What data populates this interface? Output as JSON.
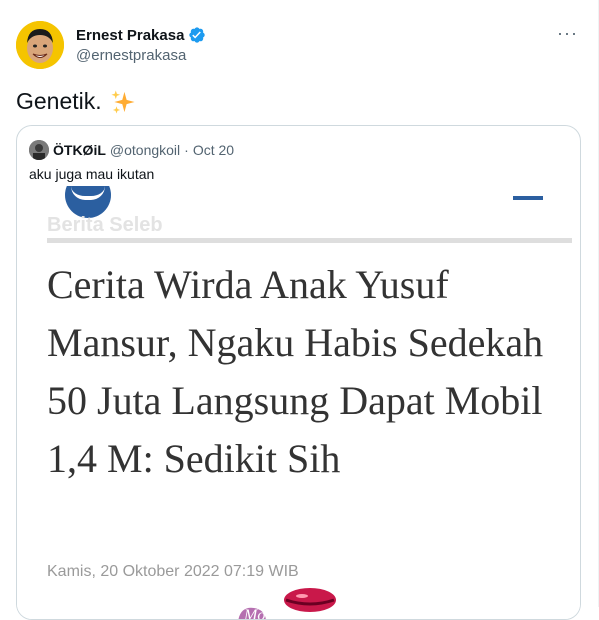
{
  "author": {
    "display_name": "Ernest Prakasa",
    "handle": "@ernestprakasa",
    "verified_icon": "verified-badge-icon",
    "avatar_bg": "#f5c400"
  },
  "tweet": {
    "text": "Genetik.",
    "emoji": "sparkles-icon"
  },
  "more_menu": "···",
  "quoted": {
    "display_name": "ÖTKØiL",
    "handle": "@otongkoil",
    "separator": "·",
    "date": "Oct 20",
    "text": "aku juga mau ikutan",
    "media": {
      "site_logo": "news-site-logo",
      "section": "Berita Seleb",
      "headline": "Cerita Wirda Anak Yusuf Mansur, Ngaku Habis Sedekah 50 Juta Langsung Dapat Mobil 1,4 M: Sedikit Sih",
      "dateline": "Kamis, 20 Oktober 2022 07:19 WIB",
      "sticker": "lips-sticker-icon"
    }
  },
  "colors": {
    "verified": "#1d9bf0",
    "secondary_text": "#536471",
    "headline_text": "#333333",
    "logo_blue": "#2b5fa0"
  }
}
